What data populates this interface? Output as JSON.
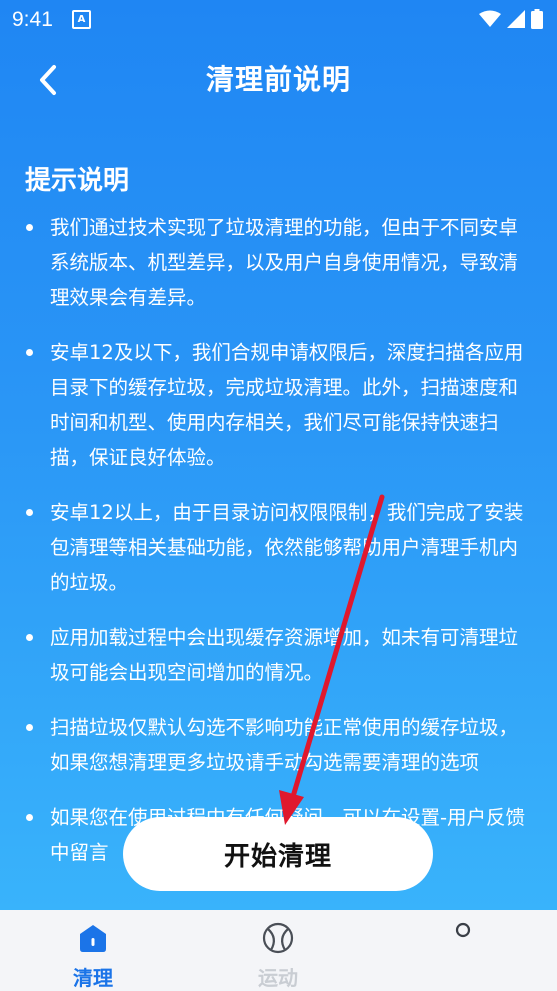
{
  "status_bar": {
    "time": "9:41",
    "notification_letter": "A"
  },
  "header": {
    "title": "清理前说明"
  },
  "section_title": "提示说明",
  "tips": [
    "我们通过技术实现了垃圾清理的功能，但由于不同安卓系统版本、机型差异，以及用户自身使用情况，导致清理效果会有差异。",
    "安卓12及以下，我们合规申请权限后，深度扫描各应用目录下的缓存垃圾，完成垃圾清理。此外，扫描速度和时间和机型、使用内存相关，我们尽可能保持快速扫描，保证良好体验。",
    "安卓12以上，由于目录访问权限限制，我们完成了安装包清理等相关基础功能，依然能够帮助用户清理手机内的垃圾。",
    "应用加载过程中会出现缓存资源增加，如未有可清理垃圾可能会出现空间增加的情况。",
    "扫描垃圾仅默认勾选不影响功能正常使用的缓存垃圾，如果您想清理更多垃圾请手动勾选需要清理的选项",
    "如果您在使用过程中有任何疑问，可以在设置-用户反馈中留言"
  ],
  "start_button": "开始清理",
  "bottom_nav": [
    {
      "label": "清理",
      "icon": "home-icon",
      "active": true
    },
    {
      "label": "运动",
      "icon": "sport-ball-icon",
      "active": false
    },
    {
      "label": "",
      "icon": "circle-icon",
      "active": false
    }
  ],
  "colors": {
    "gradient_top": "#1f86f3",
    "gradient_bottom": "#39b3fb",
    "active_nav": "#1b74e8",
    "annotation_arrow": "#e0182d"
  }
}
